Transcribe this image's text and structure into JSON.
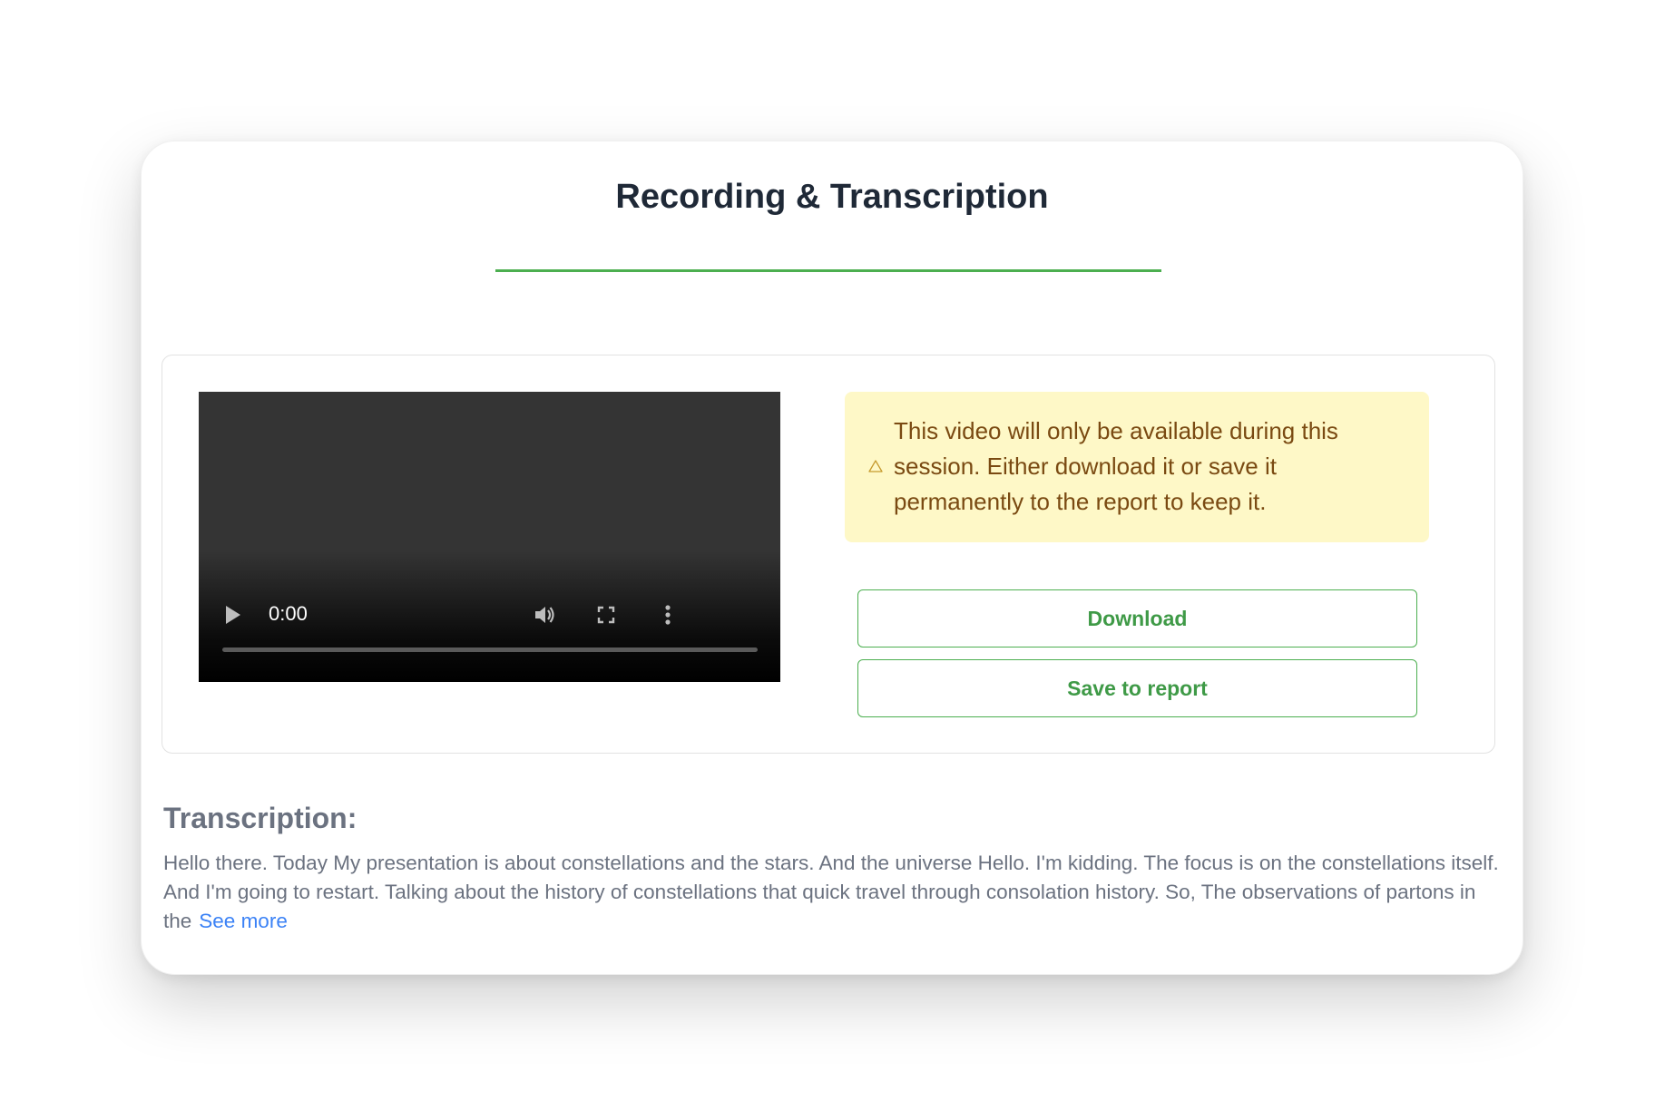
{
  "card": {
    "title": "Recording & Transcription"
  },
  "video": {
    "time": "0:00",
    "icons": {
      "play": "play-icon",
      "volume": "volume-icon",
      "fullscreen": "fullscreen-icon",
      "more": "more-vertical-icon"
    }
  },
  "notice": {
    "icon": "warning-icon",
    "text": "This video will only be available during this session. Either download it or save it permanently to the report to keep it."
  },
  "actions": {
    "download_label": "Download",
    "save_label": "Save to report"
  },
  "transcription": {
    "heading": "Transcription:",
    "text": "Hello there. Today My presentation is about constellations and the stars. And the universe Hello. I'm kidding. The focus is on the constellations itself. And I'm going to restart. Talking about the history of constellations that quick travel through consolation history. So, The observations of partons in the",
    "see_more_label": "See more"
  },
  "colors": {
    "accent": "#4caf50",
    "title_text": "#1f2937",
    "notice_bg": "#fef8c7",
    "notice_text": "#7a4a12",
    "link": "#3b82f6",
    "muted_text": "#6b7280"
  }
}
